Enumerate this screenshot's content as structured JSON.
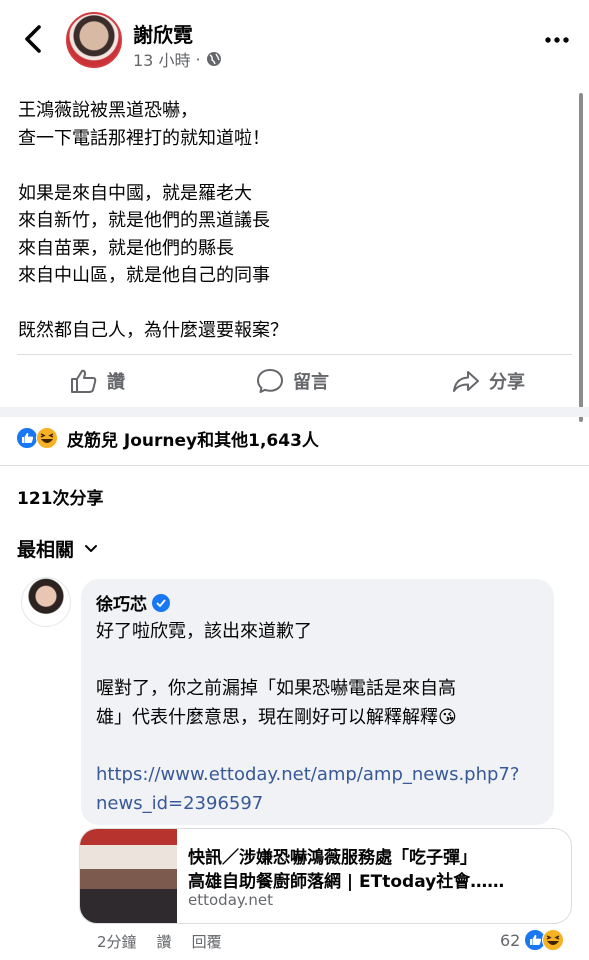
{
  "header": {
    "author": "謝欣霓",
    "time": "13 小時",
    "dot": "·",
    "icons": [
      "back-arrow-icon",
      "globe-icon",
      "more-icon"
    ]
  },
  "post": {
    "lines": [
      "王鴻薇說被黑道恐嚇，",
      "查一下電話那裡打的就知道啦！",
      "",
      "如果是來自中國，就是羅老大",
      "來自新竹，就是他們的黑道議長",
      "來自苗栗，就是他們的縣長",
      "來自中山區，就是他自己的同事",
      "",
      "既然都自己人，為什麼還要報案？"
    ]
  },
  "actions": {
    "like": "讚",
    "comment": "留言",
    "share": "分享"
  },
  "reactions": {
    "summary": "皮筋兒 Journey和其他1,643人",
    "types": [
      "like",
      "haha"
    ]
  },
  "shares": {
    "count": "121次分享"
  },
  "sort": {
    "label": "最相關"
  },
  "comment": {
    "author": "徐巧芯",
    "verified": true,
    "line1": "好了啦欣霓，該出來道歉了",
    "line2": "喔對了，你之前漏掉「如果恐嚇電話是來自高",
    "line3": "雄」代表什麼意思，現在剛好可以解釋解釋",
    "emoji": "😘",
    "link_line1": "https://www.ettoday.net/amp/amp_news.php7?",
    "link_line2": "news_id=2396597",
    "card": {
      "title_line1": "快訊／涉嫌恐嚇鴻薇服務處「吃子彈」",
      "title_line2": "高雄自助餐廚師落網 | ETtoday社會……",
      "domain": "ettoday.net"
    },
    "footer": {
      "time": "2分鐘",
      "like": "讚",
      "reply": "回覆"
    },
    "reaction_count": "62"
  },
  "colors": {
    "facebook_blue": "#1877f2",
    "secondary_text": "#65676b",
    "link_text": "#385898",
    "comment_bg": "#f0f2f5"
  }
}
